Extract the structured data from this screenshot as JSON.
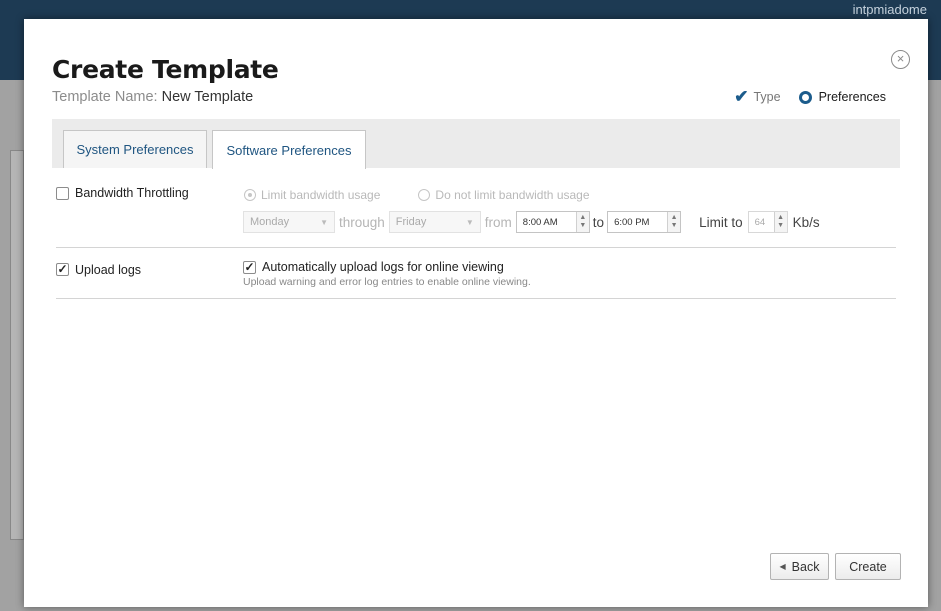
{
  "background": {
    "user_name": "intpmiadome"
  },
  "modal": {
    "title": "Create Template",
    "template_name_label": "Template Name:",
    "template_name_value": "New Template",
    "close_glyph": "×",
    "steps": [
      {
        "label": "Type",
        "state": "done"
      },
      {
        "label": "Preferences",
        "state": "current"
      }
    ],
    "tabs": [
      {
        "label": "System Preferences",
        "active": false
      },
      {
        "label": "Software Preferences",
        "active": true
      }
    ],
    "bandwidth": {
      "label": "Bandwidth Throttling",
      "checked": false,
      "radio_limit": "Limit bandwidth usage",
      "radio_no_limit": "Do not limit bandwidth usage",
      "day_from": "Monday",
      "through_label": "through",
      "day_to": "Friday",
      "from_label": "from",
      "time_from": "8:00 AM",
      "to_label": "to",
      "time_to": "6:00 PM",
      "limit_label": "Limit to",
      "limit_value": "64",
      "unit": "Kb/s"
    },
    "upload_logs": {
      "label": "Upload logs",
      "checked": true,
      "option_label": "Automatically upload logs for online viewing",
      "option_checked": true,
      "description": "Upload warning and error log entries to enable online viewing."
    },
    "buttons": {
      "back": "Back",
      "create": "Create"
    }
  },
  "colors": {
    "accent": "#1c5c8c",
    "tab_text": "#1f5581",
    "topbar": "#1d3a53"
  }
}
